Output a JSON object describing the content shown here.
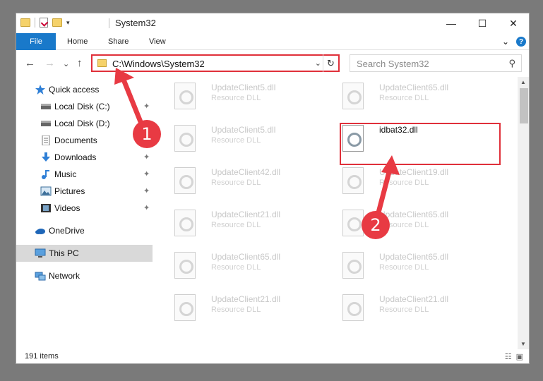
{
  "window": {
    "title": "System32",
    "minimize": "—",
    "maximize": "☐",
    "close": "✕"
  },
  "ribbon": {
    "file": "File",
    "home": "Home",
    "share": "Share",
    "view": "View",
    "expand": "⌄",
    "help": "?"
  },
  "nav": {
    "back": "←",
    "forward": "→",
    "recent": "⌄",
    "up": "↑",
    "path": "C:\\Windows\\System32",
    "dropdown": "⌄",
    "refresh": "↻",
    "search_placeholder": "Search System32",
    "search_icon": "⚲"
  },
  "sidebar": {
    "items": [
      {
        "label": "Quick access",
        "icon": "star-icon"
      },
      {
        "label": "Local Disk (C:)",
        "icon": "drive-icon",
        "pinned": true
      },
      {
        "label": "Local Disk (D:)",
        "icon": "drive-icon",
        "pinned": true
      },
      {
        "label": "Documents",
        "icon": "documents-icon",
        "pinned": true
      },
      {
        "label": "Downloads",
        "icon": "downloads-icon",
        "pinned": true
      },
      {
        "label": "Music",
        "icon": "music-icon",
        "pinned": true
      },
      {
        "label": "Pictures",
        "icon": "pictures-icon",
        "pinned": true
      },
      {
        "label": "Videos",
        "icon": "videos-icon",
        "pinned": true
      },
      {
        "label": "OneDrive",
        "icon": "cloud-icon"
      },
      {
        "label": "This PC",
        "icon": "computer-icon",
        "selected": true
      },
      {
        "label": "Network",
        "icon": "network-icon"
      }
    ],
    "pin_glyph": "📌"
  },
  "files": [
    {
      "name": "UpdateClient5.dll",
      "type": "Resource DLL"
    },
    {
      "name": "UpdateClient65.dll",
      "type": "Resource DLL"
    },
    {
      "name": "UpdateClient5.dll",
      "type": "Resource DLL"
    },
    {
      "name": "idbat32.dll",
      "type": "",
      "highlighted": true
    },
    {
      "name": "UpdateClient42.dll",
      "type": "Resource DLL"
    },
    {
      "name": "UpdateClient19.dll",
      "type": "Resource DLL"
    },
    {
      "name": "UpdateClient21.dll",
      "type": "Resource DLL"
    },
    {
      "name": "UpdateClient65.dll",
      "type": "Resource DLL"
    },
    {
      "name": "UpdateClient65.dll",
      "type": "Resource DLL"
    },
    {
      "name": "UpdateClient65.dll",
      "type": "Resource DLL"
    },
    {
      "name": "UpdateClient21.dll",
      "type": "Resource DLL"
    },
    {
      "name": "UpdateClient21.dll",
      "type": "Resource DLL"
    }
  ],
  "status": {
    "count": "191 items"
  },
  "markers": {
    "one": "1",
    "two": "2"
  },
  "colors": {
    "accent": "#1979ca",
    "annotation": "#e0303a",
    "selected": "#d9d9d9"
  }
}
